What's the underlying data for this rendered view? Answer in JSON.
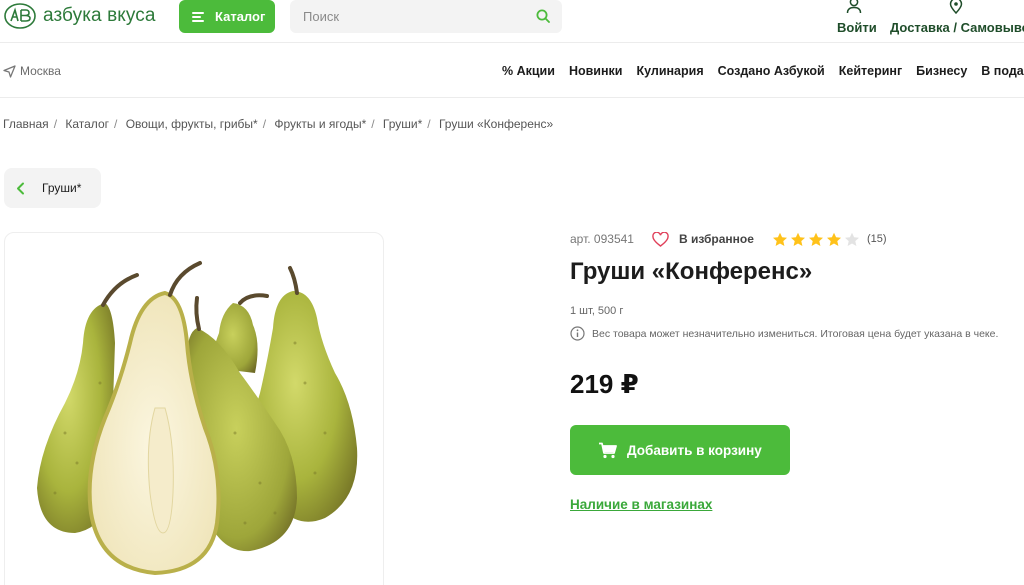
{
  "colors": {
    "brand_green": "#4cbb3b",
    "dark_green": "#1f4d2a",
    "star": "#ffc21a"
  },
  "header": {
    "logo_text": "азбука вкуса",
    "catalog_label": "Каталог",
    "search_placeholder": "Поиск",
    "login_label": "Войти",
    "delivery_label": "Доставка / Самовывоз"
  },
  "nav": {
    "city": "Москва",
    "items": [
      "% Акции",
      "Новинки",
      "Кулинария",
      "Создано Азбукой",
      "Кейтеринг",
      "Бизнесу",
      "В подарок"
    ]
  },
  "breadcrumb": [
    "Главная",
    "Каталог",
    "Овощи, фрукты, грибы*",
    "Фрукты и ягоды*",
    "Груши*",
    "Груши «Конференс»"
  ],
  "back_chip": {
    "label": "Груши*"
  },
  "product": {
    "sku": "арт. 093541",
    "favorite_label": "В избранное",
    "rating": 4,
    "rating_max": 5,
    "reviews": "(15)",
    "title": "Груши «Конференс»",
    "weight": "1 шт, 500 г",
    "notice": "Вес товара может незначительно измениться. Итоговая цена будет указана в чеке.",
    "price": "219 ₽",
    "add_to_cart": "Добавить в корзину",
    "stores_link": "Наличие в магазинах"
  },
  "icons": [
    "logo-icon",
    "burger-icon",
    "search-icon",
    "user-icon",
    "location-pin-icon",
    "navigation-arrow-icon",
    "chevron-left-icon",
    "heart-icon",
    "star-icon",
    "info-icon",
    "cart-icon"
  ]
}
